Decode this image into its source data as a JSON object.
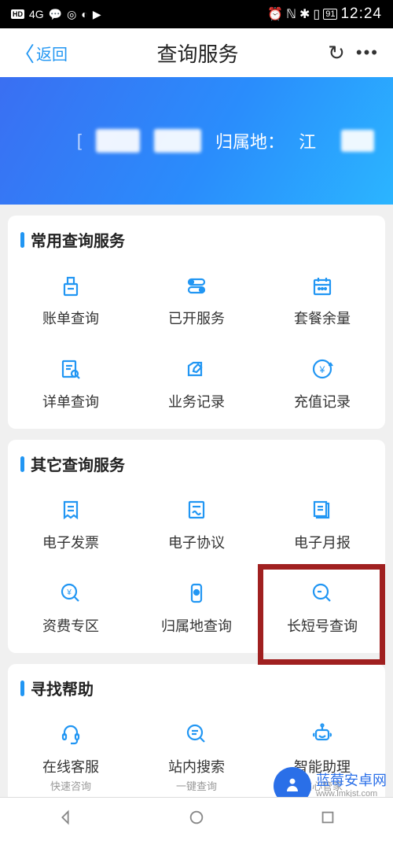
{
  "status_bar": {
    "hd": "HD",
    "signal": "4G",
    "time": "12:24",
    "battery": "91"
  },
  "header": {
    "back_label": "返回",
    "title": "查询服务"
  },
  "banner": {
    "attribution_label": "归属地：",
    "attribution_value": "江"
  },
  "sections": {
    "common": {
      "title": "常用查询服务",
      "items": [
        {
          "label": "账单查询"
        },
        {
          "label": "已开服务"
        },
        {
          "label": "套餐余量"
        },
        {
          "label": "详单查询"
        },
        {
          "label": "业务记录"
        },
        {
          "label": "充值记录"
        }
      ]
    },
    "other": {
      "title": "其它查询服务",
      "items": [
        {
          "label": "电子发票"
        },
        {
          "label": "电子协议"
        },
        {
          "label": "电子月报"
        },
        {
          "label": "资费专区"
        },
        {
          "label": "归属地查询"
        },
        {
          "label": "长短号查询"
        }
      ]
    },
    "help": {
      "title": "寻找帮助",
      "items": [
        {
          "label": "在线客服",
          "sub": "快速咨询"
        },
        {
          "label": "站内搜索",
          "sub": "一键查询"
        },
        {
          "label": "智能助理",
          "sub": "贴心管家"
        }
      ]
    }
  },
  "watermark": {
    "main": "蓝莓安卓网",
    "sub": "www.lmkjst.com"
  }
}
